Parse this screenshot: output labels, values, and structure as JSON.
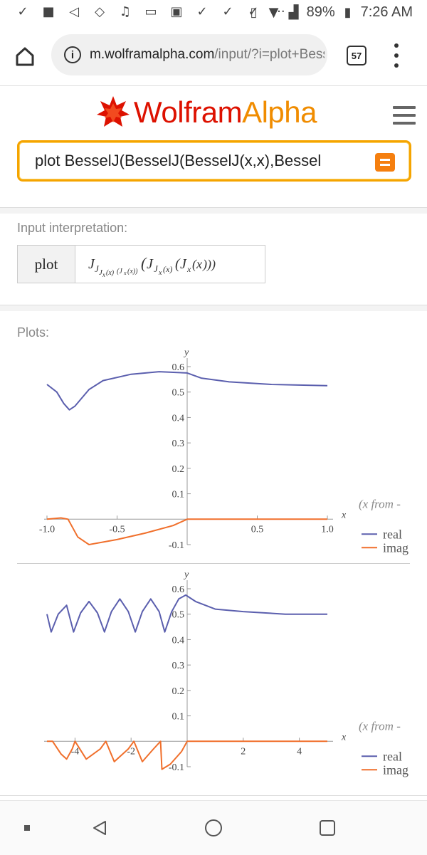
{
  "status_bar": {
    "icons": [
      "checkmark-icon",
      "facebook-icon",
      "telegram-icon",
      "shield-icon",
      "music-icon",
      "amazon-icon",
      "image-icon",
      "checkmark-icon",
      "checkmark-icon",
      "checkmark-icon"
    ],
    "more": "···",
    "battery": "89%",
    "time": "7:26 AM"
  },
  "browser": {
    "url_host": "m.wolframalpha.com",
    "url_path": "/input/?i=plot+Bess",
    "tab_count": "57"
  },
  "header": {
    "logo_wolfram": "Wolfram",
    "logo_alpha": "Alpha",
    "search_value": "plot BesselJ(BesselJ(BesselJ(x,x),Bessel"
  },
  "input_pod": {
    "title": "Input interpretation:",
    "keyword": "plot",
    "expression": "J_{J_{J_x(x)}(J_x(x))}(J_{J_x(x)}(J_x(x)))"
  },
  "plots_pod": {
    "title": "Plots:",
    "legend_header": "(x from -",
    "legend_real": "real",
    "legend_imag": "imag",
    "real_color": "#5b5fae",
    "imag_color": "#f06f2b"
  },
  "chart_data": [
    {
      "type": "line",
      "xlabel": "x",
      "ylabel": "y",
      "xlim": [
        -1.0,
        1.0
      ],
      "ylim": [
        -0.1,
        0.6
      ],
      "x_ticks": [
        "-1.0",
        "-0.5",
        "0.5",
        "1.0"
      ],
      "y_ticks": [
        "0.6",
        "0.5",
        "0.4",
        "0.3",
        "0.2",
        "0.1",
        "-0.1"
      ],
      "series": [
        {
          "name": "real",
          "x": [
            -1.0,
            -0.93,
            -0.88,
            -0.84,
            -0.8,
            -0.7,
            -0.6,
            -0.4,
            -0.2,
            0.0,
            0.1,
            0.3,
            0.6,
            1.0
          ],
          "y": [
            0.53,
            0.5,
            0.455,
            0.43,
            0.445,
            0.51,
            0.545,
            0.57,
            0.58,
            0.575,
            0.555,
            0.54,
            0.53,
            0.525
          ]
        },
        {
          "name": "imag",
          "x": [
            -1.0,
            -0.9,
            -0.85,
            -0.78,
            -0.7,
            -0.5,
            -0.3,
            -0.1,
            0.0,
            0.5,
            1.0
          ],
          "y": [
            0.0,
            0.005,
            0.0,
            -0.07,
            -0.1,
            -0.08,
            -0.055,
            -0.025,
            0.0,
            0.0,
            0.0
          ]
        }
      ]
    },
    {
      "type": "line",
      "xlabel": "x",
      "ylabel": "y",
      "xlim": [
        -5,
        5
      ],
      "ylim": [
        -0.1,
        0.6
      ],
      "x_ticks": [
        "-4",
        "-2",
        "2",
        "4"
      ],
      "y_ticks": [
        "0.6",
        "0.5",
        "0.4",
        "0.3",
        "0.2",
        "0.1",
        "-0.1"
      ],
      "series": [
        {
          "name": "real",
          "x": [
            -5.0,
            -4.85,
            -4.6,
            -4.3,
            -4.05,
            -3.8,
            -3.5,
            -3.2,
            -2.95,
            -2.7,
            -2.4,
            -2.1,
            -1.85,
            -1.6,
            -1.3,
            -1.0,
            -0.8,
            -0.55,
            -0.3,
            -0.05,
            0.3,
            1.0,
            2.0,
            3.5,
            5.0
          ],
          "y": [
            0.5,
            0.43,
            0.5,
            0.535,
            0.43,
            0.505,
            0.55,
            0.505,
            0.43,
            0.51,
            0.56,
            0.51,
            0.43,
            0.51,
            0.56,
            0.51,
            0.43,
            0.51,
            0.56,
            0.575,
            0.55,
            0.52,
            0.51,
            0.5,
            0.5
          ]
        },
        {
          "name": "imag",
          "x": [
            -5.0,
            -4.8,
            -4.5,
            -4.3,
            -4.1,
            -4.0,
            -3.6,
            -3.1,
            -2.9,
            -2.6,
            -2.1,
            -1.9,
            -1.6,
            -1.2,
            -0.95,
            -0.9,
            -0.6,
            -0.2,
            0.0,
            2.0,
            5.0
          ],
          "y": [
            0.0,
            0.0,
            -0.05,
            -0.07,
            -0.03,
            0.0,
            -0.07,
            -0.03,
            0.0,
            -0.08,
            -0.03,
            0.0,
            -0.08,
            -0.03,
            0.0,
            -0.11,
            -0.09,
            -0.04,
            0.0,
            0.0,
            0.0
          ]
        }
      ]
    }
  ]
}
